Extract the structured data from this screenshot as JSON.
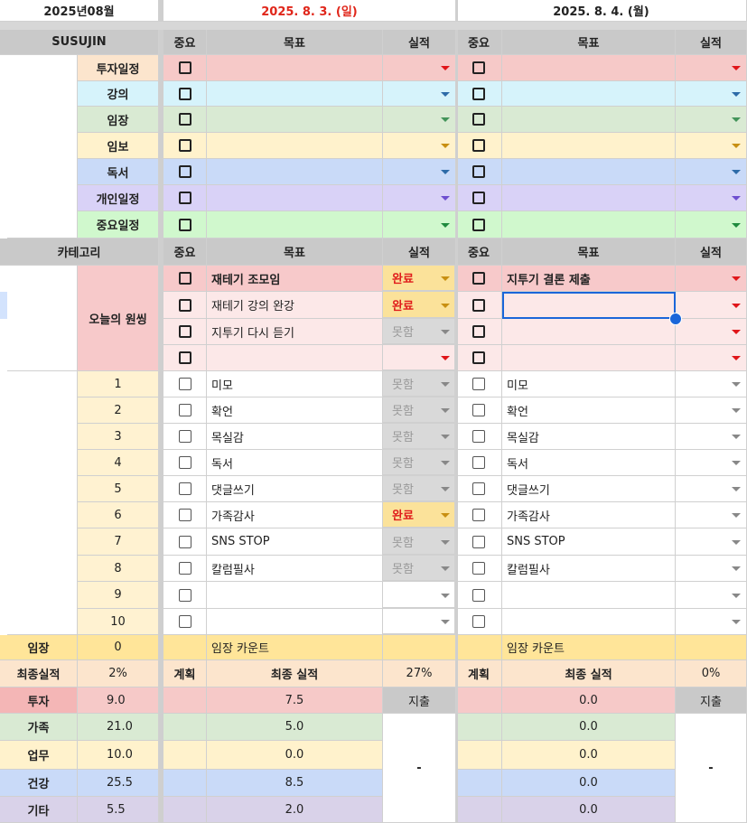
{
  "colors": {
    "invest": "#f6c9c8",
    "lecture": "#d6f3fb",
    "imjang": "#d9ead3",
    "imbo": "#fff2cc",
    "reading": "#c9daf8",
    "personal": "#d9d2f7",
    "important": "#d0f8cd",
    "wish": "#f7c9ca",
    "wish_light": "#fce8e8",
    "count": "#fff2d1",
    "header": "#c9c9c9",
    "selection": "#1a66d9"
  },
  "month": "2025년08월",
  "days": [
    {
      "date": "2025. 8. 3. (일)",
      "color": "#e0261a",
      "date_color_name": "red"
    },
    {
      "date": "2025. 8. 4. (월)",
      "color": "#222222",
      "date_color_name": "black"
    }
  ],
  "owner": "SUSUJIN",
  "col_headers": {
    "importance": "중요",
    "goal": "목표",
    "result": "실적"
  },
  "categories": [
    {
      "name": "투자일정",
      "bg": "#f6c9c8",
      "name_bg": "#fce5cd",
      "arrow": "red"
    },
    {
      "name": "강의",
      "bg": "#d6f3fb",
      "name_bg": "#d6f3fb",
      "arrow": "blue"
    },
    {
      "name": "임장",
      "bg": "#d9ead3",
      "name_bg": "#d9ead3",
      "arrow": "green"
    },
    {
      "name": "임보",
      "bg": "#fff2cc",
      "name_bg": "#fff2cc",
      "arrow": "yellow"
    },
    {
      "name": "독서",
      "bg": "#c9daf8",
      "name_bg": "#c9daf8",
      "arrow": "blue"
    },
    {
      "name": "개인일정",
      "bg": "#d9d2f7",
      "name_bg": "#d9d2f7",
      "arrow": "purple"
    },
    {
      "name": "중요일정",
      "bg": "#d0f8cd",
      "name_bg": "#d0f8cd",
      "arrow": "darkgreen"
    }
  ],
  "category_header": "카테고리",
  "wish_label": "오늘의 원씽",
  "wish_rows": [
    {
      "goal1": "재테기 조모임",
      "result1": "완료",
      "state1": "done",
      "goal2": "지투기 결론 제출",
      "bold": true
    },
    {
      "goal1": "재테기 강의 완강",
      "result1": "완료",
      "state1": "done",
      "goal2": "",
      "bold": false
    },
    {
      "goal1": "지투기 다시 듣기",
      "result1": "못함",
      "state1": "fail",
      "goal2": "",
      "bold": false
    },
    {
      "goal1": "",
      "result1": "",
      "state1": "empty",
      "goal2": "",
      "bold": false
    }
  ],
  "habit_rows": [
    {
      "n": "1",
      "goal": "미모",
      "result": "못함",
      "state": "fail"
    },
    {
      "n": "2",
      "goal": "확언",
      "result": "못함",
      "state": "fail"
    },
    {
      "n": "3",
      "goal": "목실감",
      "result": "못함",
      "state": "fail"
    },
    {
      "n": "4",
      "goal": "독서",
      "result": "못함",
      "state": "fail"
    },
    {
      "n": "5",
      "goal": "댓글쓰기",
      "result": "못함",
      "state": "fail"
    },
    {
      "n": "6",
      "goal": "가족감사",
      "result": "완료",
      "state": "done"
    },
    {
      "n": "7",
      "goal": "SNS STOP",
      "result": "못함",
      "state": "fail"
    },
    {
      "n": "8",
      "goal": "칼럼필사",
      "result": "못함",
      "state": "fail"
    },
    {
      "n": "9",
      "goal": "",
      "result": "",
      "state": "empty"
    },
    {
      "n": "10",
      "goal": "",
      "result": "",
      "state": "empty"
    }
  ],
  "imjang": {
    "label": "임장",
    "value": "0",
    "count_label": "임장 카운트"
  },
  "final": {
    "label": "최종실적",
    "value": "2%",
    "plan": "계획",
    "final_label": "최종 실적",
    "pct1": "27%",
    "pct2": "0%"
  },
  "expense": "지출",
  "dash": "-",
  "summary": [
    {
      "label": "투자",
      "value": "9.0",
      "d1": "7.5",
      "d2": "0.0",
      "bg": "#f6c9c8",
      "label_bg": "#f4b6b6"
    },
    {
      "label": "가족",
      "value": "21.0",
      "d1": "5.0",
      "d2": "0.0",
      "bg": "#d9ead3",
      "label_bg": "#d9ead3"
    },
    {
      "label": "업무",
      "value": "10.0",
      "d1": "0.0",
      "d2": "0.0",
      "bg": "#fff2cc",
      "label_bg": "#fff2cc"
    },
    {
      "label": "건강",
      "value": "25.5",
      "d1": "8.5",
      "d2": "0.0",
      "bg": "#c9daf8",
      "label_bg": "#c9daf8"
    },
    {
      "label": "기타",
      "value": "5.5",
      "d1": "2.0",
      "d2": "0.0",
      "bg": "#d9d2e9",
      "label_bg": "#d9d2e9"
    }
  ]
}
